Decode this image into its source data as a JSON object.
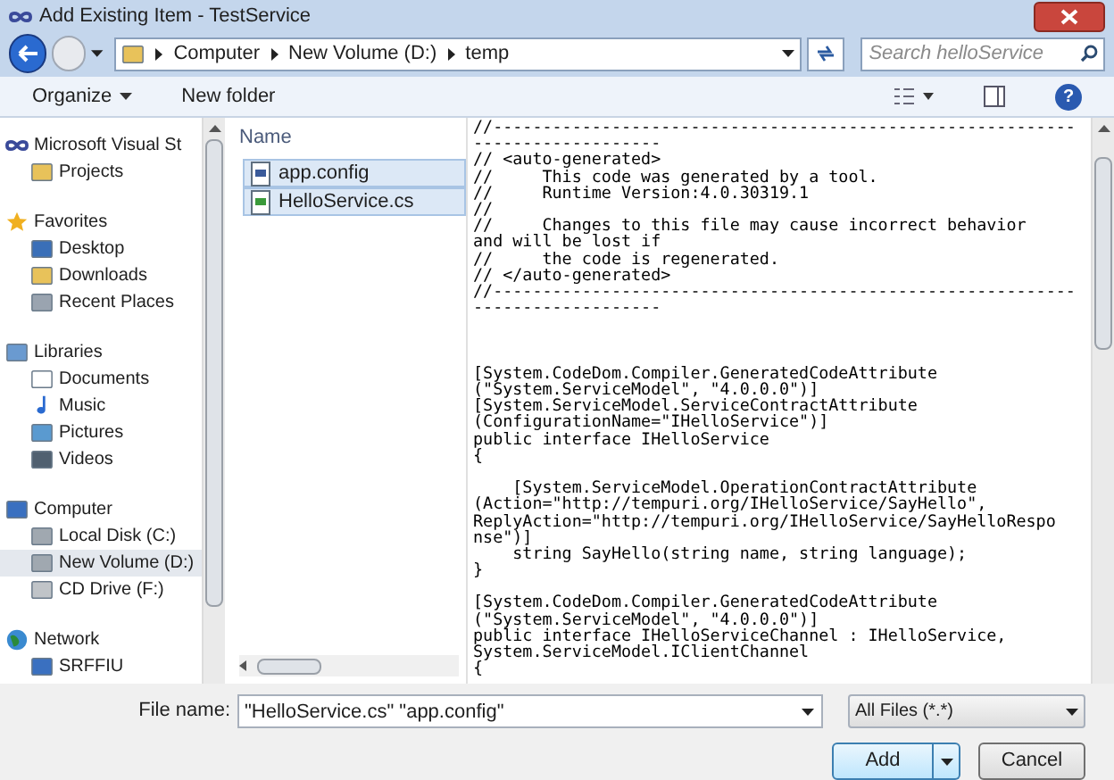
{
  "window": {
    "title": "Add Existing Item - TestService"
  },
  "address": {
    "crumbs": [
      "Computer",
      "New Volume (D:)",
      "temp"
    ],
    "search_placeholder": "Search helloService"
  },
  "toolbar": {
    "organize": "Organize",
    "new_folder": "New folder",
    "help": "?"
  },
  "sidebar": {
    "groups": [
      {
        "label": "Microsoft Visual St",
        "children": [
          {
            "label": "Projects",
            "selected": false
          }
        ]
      },
      {
        "label": "Favorites",
        "children": [
          {
            "label": "Desktop",
            "selected": false
          },
          {
            "label": "Downloads",
            "selected": false
          },
          {
            "label": "Recent Places",
            "selected": false
          }
        ]
      },
      {
        "label": "Libraries",
        "children": [
          {
            "label": "Documents",
            "selected": false
          },
          {
            "label": "Music",
            "selected": false
          },
          {
            "label": "Pictures",
            "selected": false
          },
          {
            "label": "Videos",
            "selected": false
          }
        ]
      },
      {
        "label": "Computer",
        "children": [
          {
            "label": "Local Disk (C:)",
            "selected": false
          },
          {
            "label": "New Volume (D:)",
            "selected": true
          },
          {
            "label": "CD Drive (F:)",
            "selected": false
          }
        ]
      },
      {
        "label": "Network",
        "children": [
          {
            "label": "SRFFIU",
            "selected": false
          }
        ]
      }
    ]
  },
  "files": {
    "column": "Name",
    "items": [
      {
        "name": "app.config",
        "selected": true
      },
      {
        "name": "HelloService.cs",
        "selected": true
      }
    ]
  },
  "preview": {
    "blocks": [
      {
        "lines": [
          "//-----------------------------------------------------------",
          "-------------------",
          "// <auto-generated>",
          "//     This code was generated by a tool.",
          "//     Runtime Version:4.0.30319.1",
          "//",
          "//     Changes to this file may cause incorrect behavior",
          "and will be lost if",
          "//     the code is regenerated.",
          "// </auto-generated>",
          "//-----------------------------------------------------------",
          "-------------------"
        ]
      },
      {
        "lines": [
          "[System.CodeDom.Compiler.GeneratedCodeAttribute",
          "(\"System.ServiceModel\", \"4.0.0.0\")]",
          "[System.ServiceModel.ServiceContractAttribute",
          "(ConfigurationName=\"IHelloService\")]",
          "public interface IHelloService",
          "{"
        ]
      },
      {
        "lines": [
          "    [System.ServiceModel.OperationContractAttribute",
          "(Action=\"http://tempuri.org/IHelloService/SayHello\",",
          "ReplyAction=\"http://tempuri.org/IHelloService/SayHelloRespo",
          "nse\")]",
          "    string SayHello(string name, string language);",
          "}"
        ]
      },
      {
        "lines": [
          "[System.CodeDom.Compiler.GeneratedCodeAttribute",
          "(\"System.ServiceModel\", \"4.0.0.0\")]",
          "public interface IHelloServiceChannel : IHelloService,",
          "System.ServiceModel.IClientChannel",
          "{"
        ]
      }
    ]
  },
  "footer": {
    "file_name_label": "File name:",
    "file_name": "\"HelloService.cs\" \"app.config\"",
    "filter": "All Files (*.*)",
    "add": "Add",
    "cancel": "Cancel"
  }
}
